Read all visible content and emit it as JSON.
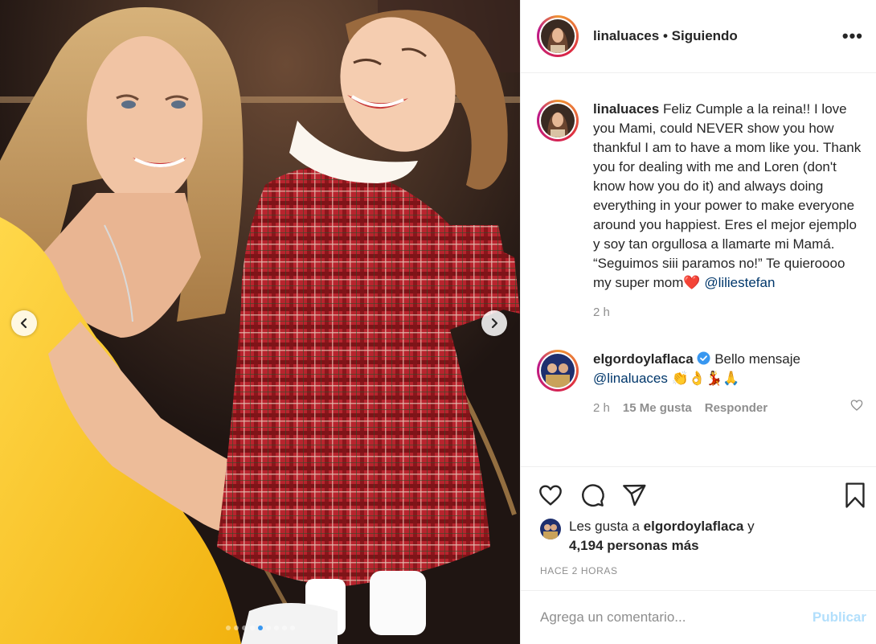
{
  "photo": {
    "carousel_index": 5,
    "carousel_count": 9
  },
  "header": {
    "username": "linaluaces",
    "separator": "•",
    "follow_status": "Siguiendo",
    "more_label": "•••"
  },
  "caption": {
    "username": "linaluaces",
    "text": "Feliz Cumple a la reina!! I love you Mami, could NEVER show you how thankful I am to have a mom like you. Thank you for dealing with me and Loren (don't know how you do it) and always doing everything in your power to make everyone around you happiest. Eres el mejor ejemplo y soy tan orgullosa a llamarte mi Mamá. “Seguimos siii paramos no!” Te quieroooo my super mom❤️",
    "mention": "@liliestefan",
    "time": "2 h"
  },
  "reply": {
    "username": "elgordoylaflaca",
    "text": "Bello mensaje",
    "mention": "@linaluaces",
    "emojis": "👏👌💃🙏",
    "time": "2 h",
    "likes": "15 Me gusta",
    "reply_label": "Responder"
  },
  "likes": {
    "prefix": "Les gusta a",
    "user": "elgordoylaflaca",
    "connector": "y",
    "others": "4,194 personas más"
  },
  "timestamp": "HACE 2 HORAS",
  "add_comment": {
    "placeholder": "Agrega un comentario...",
    "publish_label": "Publicar"
  },
  "colors": {
    "accent_blue": "#3897f0",
    "publish_disabled": "#b2dffc",
    "verified": "#3897f0",
    "text": "#262626",
    "muted": "#8e8e8e"
  }
}
